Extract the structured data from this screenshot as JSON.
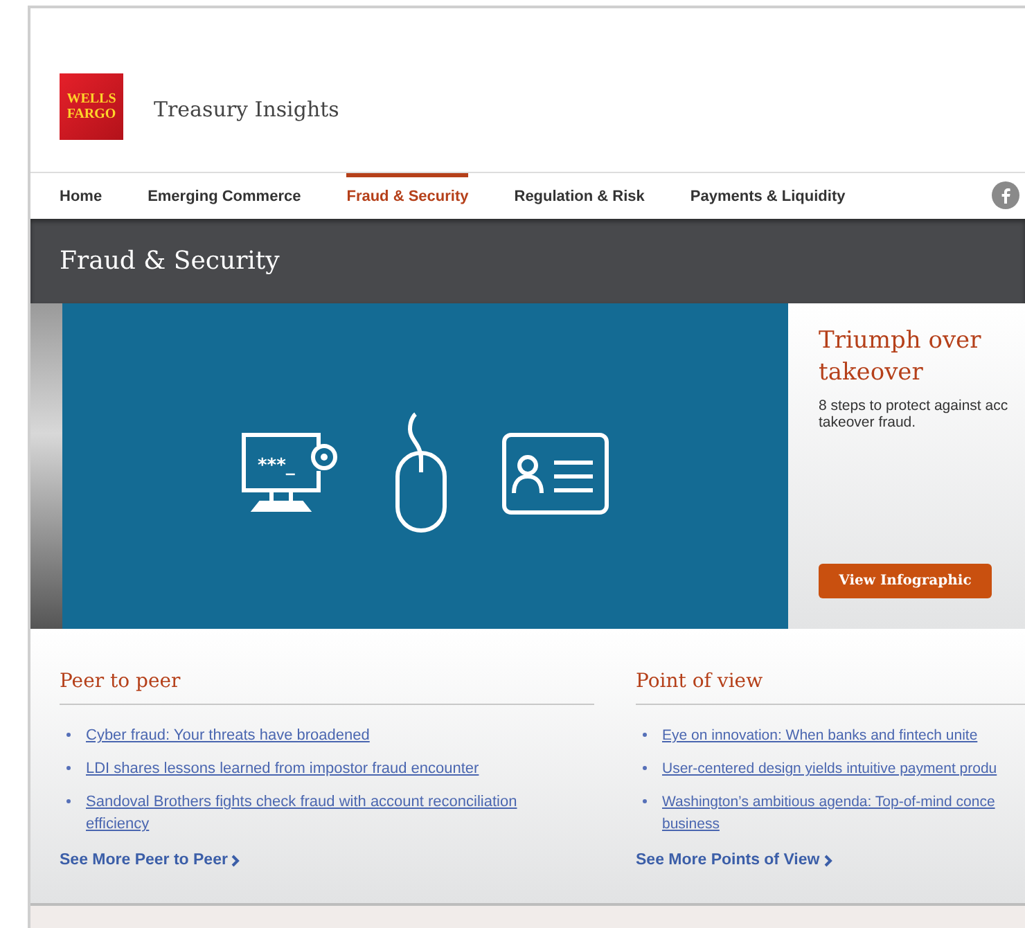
{
  "header": {
    "logo": {
      "line_1": "WELLS",
      "line_2": "FARGO"
    },
    "site_title": "Treasury Insights"
  },
  "nav": {
    "items": [
      {
        "label": "Home",
        "selected": false
      },
      {
        "label": "Emerging Commerce",
        "selected": false
      },
      {
        "label": "Fraud & Security",
        "selected": true
      },
      {
        "label": "Regulation & Risk",
        "selected": false
      },
      {
        "label": "Payments & Liquidity",
        "selected": false
      }
    ]
  },
  "page_title": "Fraud & Security",
  "hero": {
    "password_text": "***_",
    "title": "Triumph over takeover",
    "description_lines": [
      "8 steps to protect against acc",
      "takeover fraud."
    ],
    "button": "View Infographic"
  },
  "sections": [
    {
      "title": "Peer to peer",
      "links": [
        "Cyber fraud: Your threats have broadened",
        "LDI shares lessons learned from impostor fraud encounter",
        "Sandoval Brothers fights check fraud with account reconciliation efficiency"
      ],
      "more": "See More Peer to Peer"
    },
    {
      "title": "Point of view",
      "links": [
        "Eye on innovation: When banks and fintech unite",
        "User-centered design yields intuitive payment produ",
        "Washington’s ambitious agenda: Top-of-mind conce business"
      ],
      "more": "See More Points of View"
    }
  ]
}
